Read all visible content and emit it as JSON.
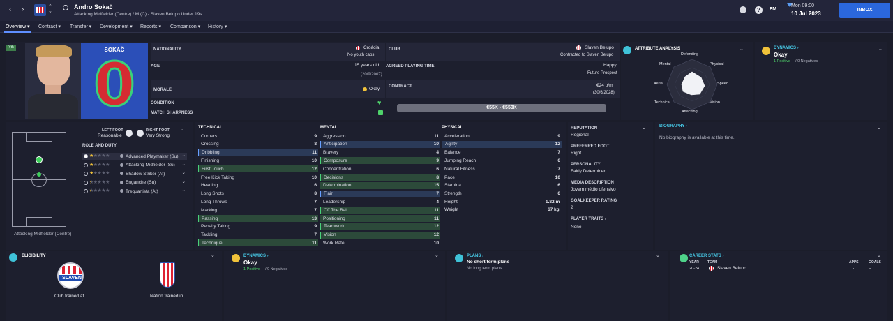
{
  "header": {
    "name": "Andro Sokač",
    "subtitle": "Attacking Midfielder (Centre) / M (C) - Slaven Belupo Under 19s",
    "time": "Mon 09:00",
    "date": "10 Jul 2023",
    "inbox": "INBOX",
    "fm": "FM"
  },
  "tabs": [
    "Overview",
    "Contract",
    "Transfer",
    "Development",
    "Reports",
    "Comparison",
    "History"
  ],
  "profile": {
    "shirt_name": "SOKAČ",
    "shirt_number": "0",
    "badge": "Yth",
    "nationality_label": "NATIONALITY",
    "nationality": "Croácia",
    "youth_caps": "No youth caps",
    "age_label": "AGE",
    "age": "15 years old",
    "dob": "(20/9/2007)",
    "morale_label": "MORALE",
    "morale": "Okay",
    "condition_label": "CONDITION",
    "sharpness_label": "MATCH SHARPNESS",
    "club_label": "CLUB",
    "club": "Slaven Belupo",
    "club_contract": "Contracted to Slaven Belupo",
    "playing_time_label": "AGREED PLAYING TIME",
    "playing_time": "Happy",
    "prospect": "Future Prospect",
    "contract_label": "CONTRACT",
    "wage": "€24 p/m",
    "contract_end": "(30/6/2028)",
    "value": "€55K - €550K"
  },
  "attr_analysis": {
    "title": "ATTRIBUTE ANALYSIS",
    "labels": [
      "Defending",
      "Physical",
      "Speed",
      "Vision",
      "Attacking",
      "Technical",
      "Aerial",
      "Mental"
    ]
  },
  "dynamics": {
    "title": "DYNAMICS",
    "status": "Okay",
    "positives": "1 Positive",
    "negatives": "0 Negatives"
  },
  "feet": {
    "left_label": "LEFT FOOT",
    "left": "Reasonable",
    "right_label": "RIGHT FOOT",
    "right": "Very Strong"
  },
  "roles": {
    "title": "ROLE AND DUTY",
    "items": [
      "Advanced Playmaker (Su)",
      "Attacking Midfielder (Su)",
      "Shadow Striker (At)",
      "Enganche (Su)",
      "Trequartista (At)"
    ],
    "stars": [
      1,
      1,
      1,
      0.5,
      0.5
    ],
    "position": "Attacking Midfielder (Centre)"
  },
  "technical": {
    "title": "TECHNICAL",
    "rows": [
      [
        "Corners",
        "9"
      ],
      [
        "Crossing",
        "8"
      ],
      [
        "Dribbling",
        "11"
      ],
      [
        "Finishing",
        "10"
      ],
      [
        "First Touch",
        "12"
      ],
      [
        "Free Kick Taking",
        "10"
      ],
      [
        "Heading",
        "6"
      ],
      [
        "Long Shots",
        "8"
      ],
      [
        "Long Throws",
        "7"
      ],
      [
        "Marking",
        "7"
      ],
      [
        "Passing",
        "13"
      ],
      [
        "Penalty Taking",
        "9"
      ],
      [
        "Tackling",
        "7"
      ],
      [
        "Technique",
        "11"
      ]
    ]
  },
  "mental": {
    "title": "MENTAL",
    "rows": [
      [
        "Aggression",
        "11"
      ],
      [
        "Anticipation",
        "10"
      ],
      [
        "Bravery",
        "4"
      ],
      [
        "Composure",
        "9"
      ],
      [
        "Concentration",
        "6"
      ],
      [
        "Decisions",
        "8"
      ],
      [
        "Determination",
        "15"
      ],
      [
        "Flair",
        "7"
      ],
      [
        "Leadership",
        "4"
      ],
      [
        "Off The Ball",
        "11"
      ],
      [
        "Positioning",
        "11"
      ],
      [
        "Teamwork",
        "12"
      ],
      [
        "Vision",
        "12"
      ],
      [
        "Work Rate",
        "10"
      ]
    ]
  },
  "physical": {
    "title": "PHYSICAL",
    "rows": [
      [
        "Acceleration",
        "9"
      ],
      [
        "Agility",
        "12"
      ],
      [
        "Balance",
        "7"
      ],
      [
        "Jumping Reach",
        "6"
      ],
      [
        "Natural Fitness",
        "7"
      ],
      [
        "Pace",
        "10"
      ],
      [
        "Stamina",
        "6"
      ],
      [
        "Strength",
        "6"
      ]
    ],
    "height_label": "Height",
    "height": "1.82 m",
    "weight_label": "Weight",
    "weight": "67 kg"
  },
  "info": {
    "reputation_label": "REPUTATION",
    "reputation": "Regional",
    "foot_label": "PREFERRED FOOT",
    "foot": "Right",
    "personality_label": "PERSONALITY",
    "personality": "Fairly Determined",
    "media_label": "MEDIA DESCRIPTION",
    "media": "Jovem médio ofensivo",
    "gk_label": "GOALKEEPER RATING",
    "gk": "2",
    "traits_label": "PLAYER TRAITS",
    "traits": "None"
  },
  "bio": {
    "title": "BIOGRAPHY",
    "text": "No biography is available at this time."
  },
  "eligibility": {
    "title": "ELIGIBILITY",
    "club": "Club trained at",
    "nation": "Nation trained in",
    "club_badge": "SLAVEN"
  },
  "plans": {
    "title": "PLANS",
    "short": "No short term plans",
    "long": "No long term plans"
  },
  "career": {
    "title": "CAREER STATS",
    "year_label": "YEAR",
    "team_label": "TEAM",
    "apps_label": "APPS",
    "goals_label": "GOALS",
    "year": "20-24",
    "team": "Slaven Belupo",
    "apps": "-",
    "goals": "-"
  }
}
